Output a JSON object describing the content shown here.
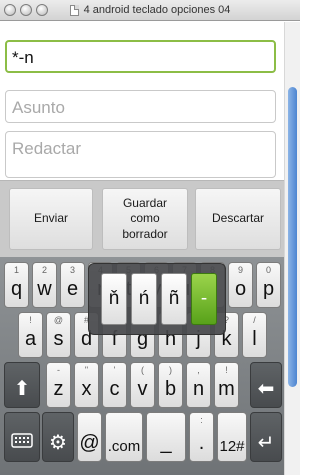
{
  "window": {
    "title": "4 android teclado opciones 04"
  },
  "compose": {
    "to_value": "*-n",
    "subject_placeholder": "Asunto",
    "body_placeholder": "Redactar"
  },
  "actions": {
    "send": "Enviar",
    "save_draft": "Guardar como borrador",
    "discard": "Descartar"
  },
  "keyboard": {
    "rows": [
      [
        {
          "label": "q",
          "hint": "1"
        },
        {
          "label": "w",
          "hint": "2"
        },
        {
          "label": "e",
          "hint": "3"
        },
        {
          "label": "r",
          "hint": "4"
        },
        {
          "label": "t",
          "hint": "5"
        },
        {
          "label": "y",
          "hint": "6"
        },
        {
          "label": "u",
          "hint": "7"
        },
        {
          "label": "i",
          "hint": "8"
        },
        {
          "label": "o",
          "hint": "9"
        },
        {
          "label": "p",
          "hint": "0"
        }
      ],
      [
        {
          "label": "a",
          "hint": "!"
        },
        {
          "label": "s",
          "hint": "@"
        },
        {
          "label": "d",
          "hint": "#"
        },
        {
          "label": "f",
          "hint": "$"
        },
        {
          "label": "g",
          "hint": "%"
        },
        {
          "label": "h",
          "hint": "&"
        },
        {
          "label": "j",
          "hint": "*"
        },
        {
          "label": "k",
          "hint": "?"
        },
        {
          "label": "l",
          "hint": "/"
        }
      ],
      [
        {
          "label": "z",
          "hint": "-"
        },
        {
          "label": "x",
          "hint": "\""
        },
        {
          "label": "c",
          "hint": "'"
        },
        {
          "label": "v",
          "hint": "("
        },
        {
          "label": "b",
          "hint": ")"
        },
        {
          "label": "n",
          "hint": ","
        },
        {
          "label": "m",
          "hint": "!"
        }
      ]
    ],
    "bottom": {
      "at": "@",
      "dotcom": ".com",
      "underscore": "_",
      "period": ".",
      "period_hint": ":",
      "numbers": "12#"
    },
    "popup_options": [
      {
        "label": "ň",
        "selected": false
      },
      {
        "label": "ń",
        "selected": false
      },
      {
        "label": "ñ",
        "selected": false
      },
      {
        "label": "-",
        "selected": true
      }
    ]
  },
  "colors": {
    "focus_border": "#8cbd46",
    "selected_key": "#58a21a",
    "keyboard_bg": "#7d8184",
    "scroll_thumb": "#4d85d1"
  }
}
